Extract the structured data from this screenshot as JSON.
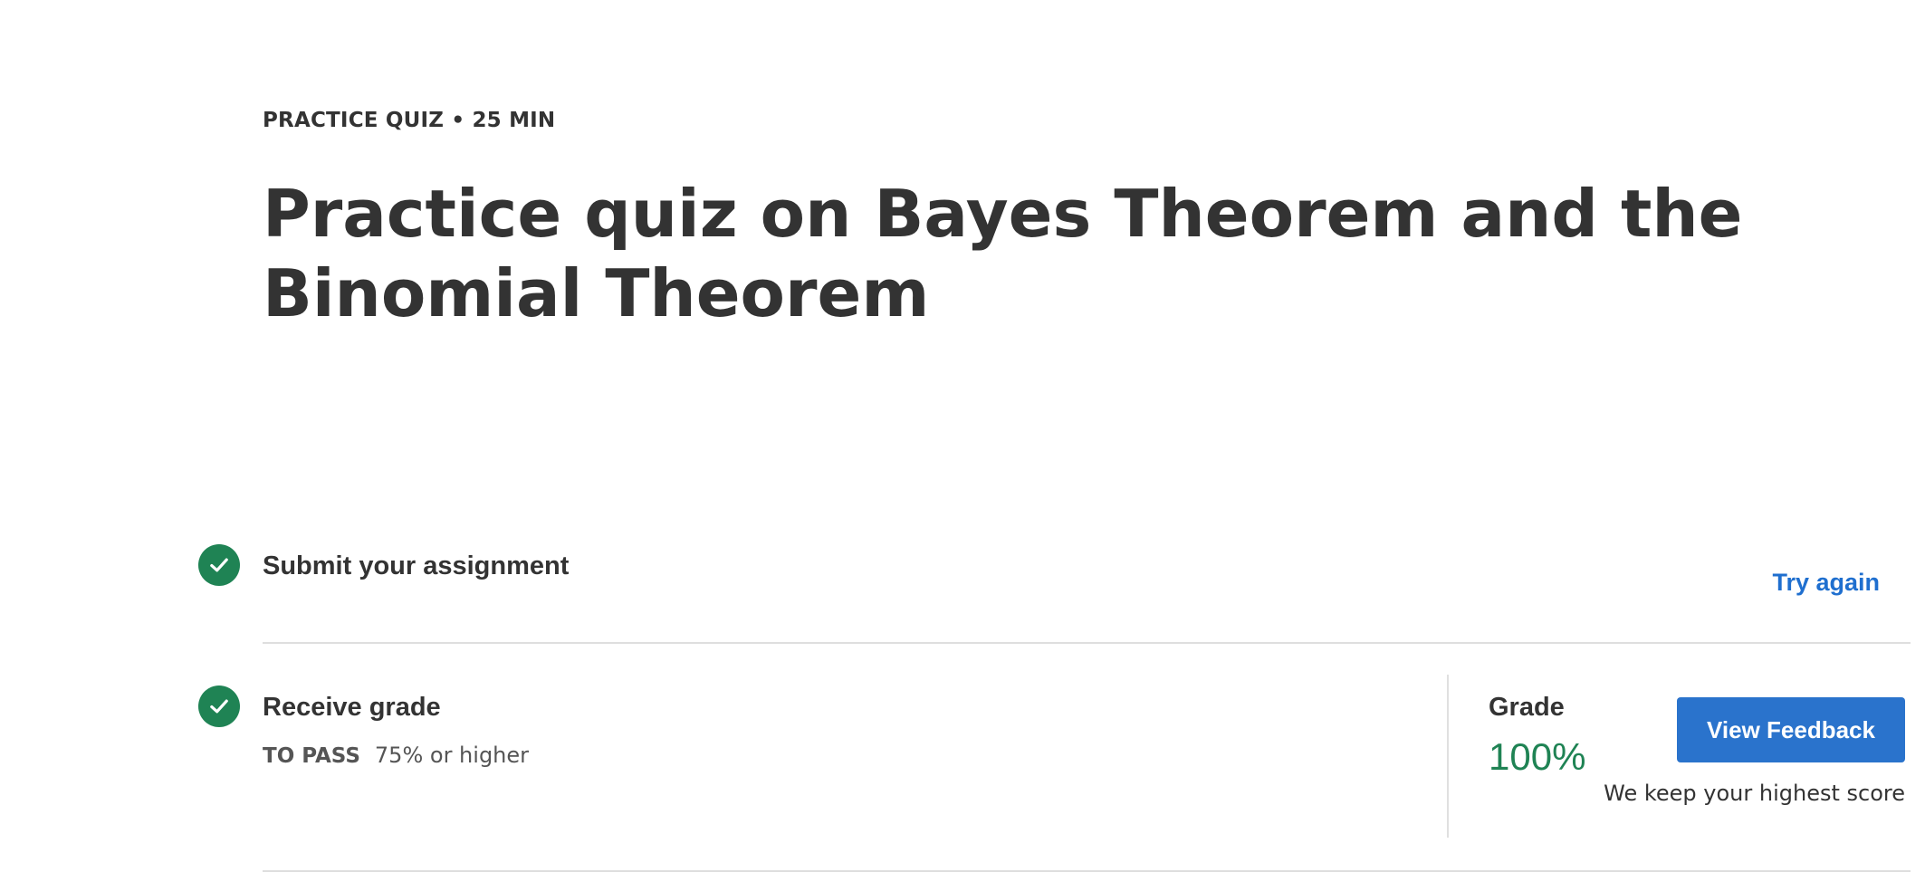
{
  "header": {
    "eyebrow": "PRACTICE QUIZ • 25 MIN",
    "title": "Practice quiz on Bayes Theorem and the Binomial Theorem"
  },
  "steps": {
    "submit": {
      "title": "Submit your assignment",
      "status_icon": "check-circle-icon",
      "action_label": "Try again"
    },
    "grade": {
      "title": "Receive grade",
      "status_icon": "check-circle-icon",
      "to_pass_label": "TO PASS",
      "to_pass_value": "75% or higher",
      "grade_label": "Grade",
      "grade_value": "100%",
      "feedback_label": "View Feedback",
      "score_note": "We keep your highest score"
    }
  },
  "colors": {
    "success": "#1f8354",
    "link": "#1f6fcf",
    "primary_button": "#2a73cc",
    "text": "#333333",
    "divider": "#dedede"
  }
}
